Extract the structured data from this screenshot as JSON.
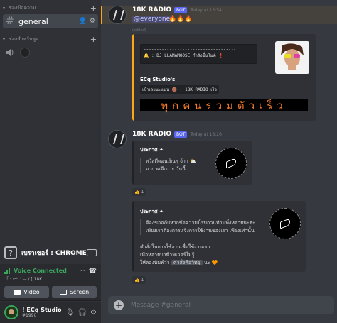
{
  "sidebar": {
    "category_text": "ช่องข้อความ",
    "category_voice": "ช่องสำหรับพูด",
    "channel": {
      "name": "general"
    },
    "status": {
      "label": "เบราเซอร์ : CHROME"
    },
    "voice": {
      "title": "Voice Connected",
      "subtitle": "「 · ʸᵃˡᵏ ° ₒₙ / [ 18K ...",
      "video_label": "Video",
      "screen_label": "Screen"
    },
    "user": {
      "name": "! ECq Studio...",
      "tag": "#1990"
    }
  },
  "messages": [
    {
      "author": "18K RADIO",
      "bot_tag": "BOT",
      "timestamp": "Today at 13:54",
      "mention": "@everyone",
      "fire": "🔥🔥🔥",
      "edited": "(edited)",
      "embed": {
        "code_line1": "🔔 : DJ LLAMAMOOSE",
        "code_line2": "กำลังขึ้นไมค์",
        "code_mark": "❗",
        "author": "ECq Studio's",
        "inline_code": "เข้าเลยนะแนน 🟤 : 18K RADIO เร็ว",
        "banner": "ทุกคนรวมตัวเร็ว"
      }
    },
    {
      "author": "18K RADIO",
      "bot_tag": "BOT",
      "timestamp": "Today at 18:26",
      "embed1": {
        "header": "ประกาศ ✦",
        "line1": "สวัสดีตอนเย็นๆ จ้าา ⛅",
        "line2": "อากาศดีเนาะ วันนี้",
        "reaction_emoji": "👍",
        "reaction_count": "1"
      },
      "embed2": {
        "header": "ประกาศ ✦",
        "line1": "ต้องขออภัยหากข้อความนี้รบกวนท่านทั้งหลายนะฮะ",
        "line2": "เพียงเราต้องการแจ้งการใช้งานของเรา เพียงเท่านั้น",
        "line3": "คำสั่งในการใช้งานเพื่อใช้งานเรา",
        "line4": "เมื่อหลายบาซ้าฟเวอร์ไม่รู้",
        "line5_a": "ให้ลองพิมพ์ว่า",
        "line5_chip": "คำสั่งคือวิทยุ",
        "line5_b": "นะ 🧡",
        "reaction_emoji": "👍",
        "reaction_count": "1"
      }
    }
  ],
  "composer": {
    "placeholder": "Message #general"
  },
  "colors": {
    "accent": "#faa81a",
    "brand": "#5865f2",
    "voice_green": "#3ba55d"
  }
}
